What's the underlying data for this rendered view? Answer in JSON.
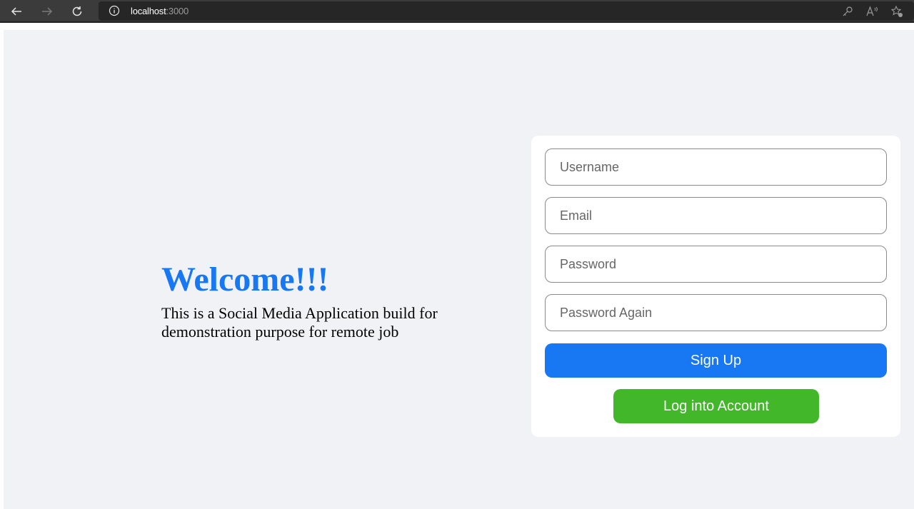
{
  "browser": {
    "url_host": "localhost",
    "url_port": ":3000",
    "icons": [
      "back-arrow-icon",
      "forward-arrow-icon",
      "reload-icon",
      "info-icon",
      "key-icon",
      "read-aloud-icon",
      "favorites-icon"
    ]
  },
  "hero": {
    "title": "Welcome!!!",
    "description": "This is a Social Media Application build for demonstration purpose for remote job"
  },
  "form": {
    "username_placeholder": "Username",
    "email_placeholder": "Email",
    "password_placeholder": "Password",
    "password_again_placeholder": "Password Again",
    "signup_label": "Sign Up",
    "login_label": "Log into Account"
  },
  "colors": {
    "brand_blue": "#1877f2",
    "login_green": "#42b72a",
    "page_bg": "#f0f2f5"
  }
}
